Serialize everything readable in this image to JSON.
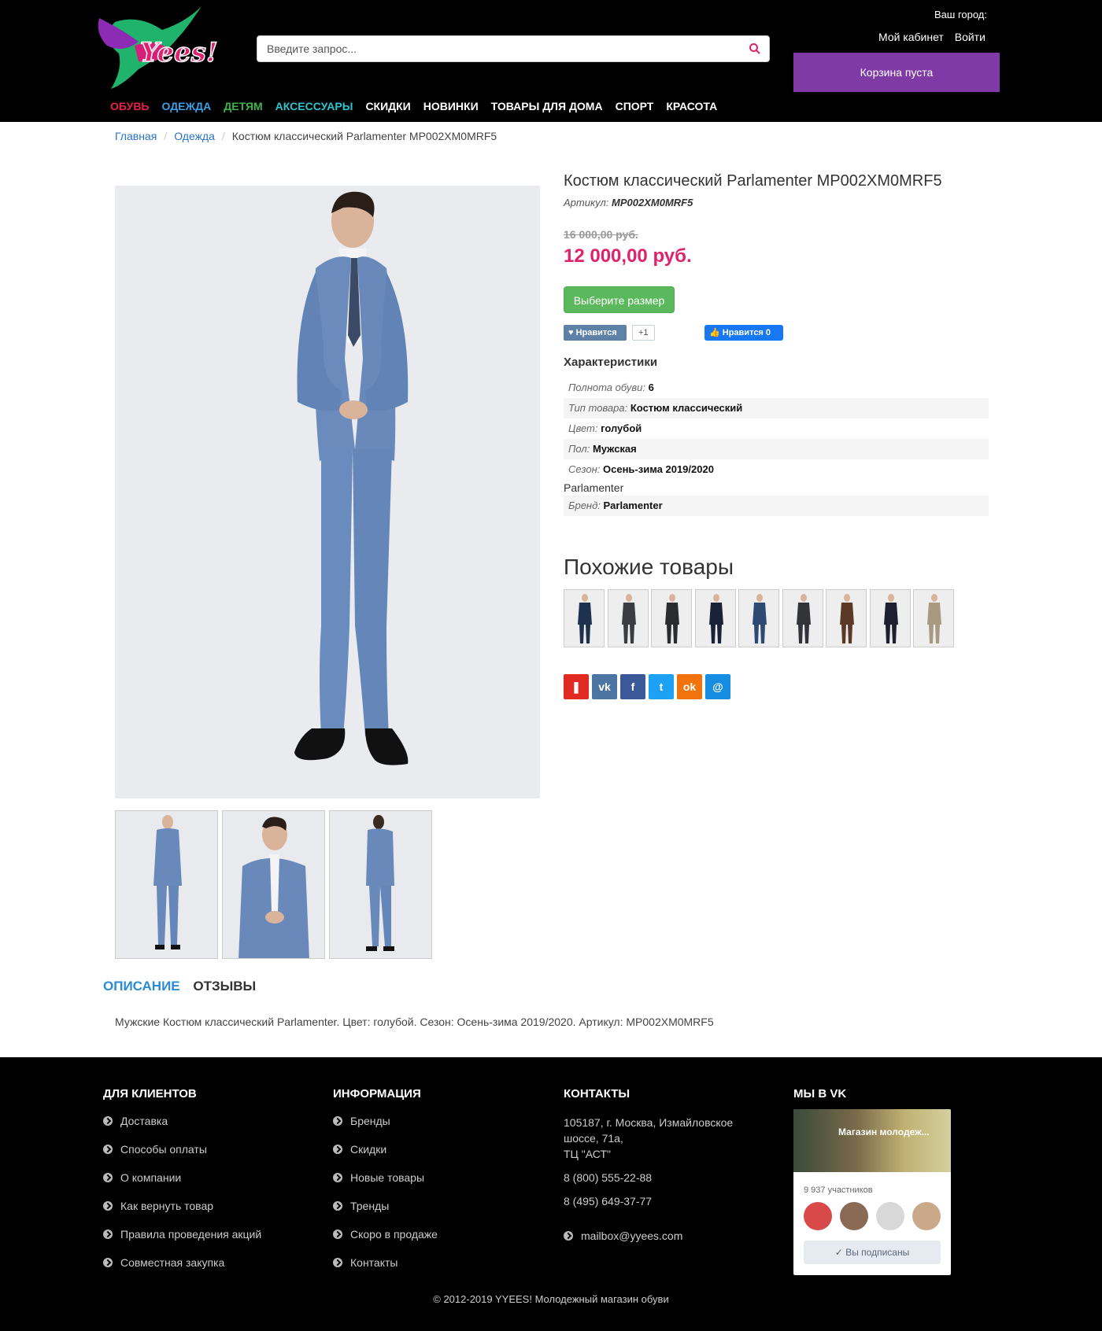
{
  "header": {
    "search_placeholder": "Введите запрос...",
    "city_label": "Ваш город:",
    "account_label": "Мой кабинет",
    "login_label": "Войти",
    "cart_label": "Корзина пуста",
    "logo_text": "Yees!"
  },
  "nav": [
    {
      "label": "ОБУВЬ",
      "color": "#e8204e"
    },
    {
      "label": "ОДЕЖДА",
      "color": "#3aa0e8"
    },
    {
      "label": "ДЕТЯМ",
      "color": "#3cb44a"
    },
    {
      "label": "АКСЕССУАРЫ",
      "color": "#29c6d0"
    },
    {
      "label": "СКИДКИ",
      "color": "#ffffff"
    },
    {
      "label": "НОВИНКИ",
      "color": "#ffffff"
    },
    {
      "label": "ТОВАРЫ ДЛЯ ДОМА",
      "color": "#ffffff"
    },
    {
      "label": "СПОРТ",
      "color": "#ffffff"
    },
    {
      "label": "КРАСОТА",
      "color": "#ffffff"
    }
  ],
  "breadcrumb": {
    "home": "Главная",
    "category": "Одежда",
    "current": "Костюм классический Parlamenter MP002XM0MRF5"
  },
  "product": {
    "title": "Костюм классический Parlamenter MP002XM0MRF5",
    "article_label": "Артикул:",
    "article_value": "MP002XM0MRF5",
    "old_price": "16 000,00 руб.",
    "new_price": "12 000,00 руб.",
    "size_button": "Выберите размер",
    "vk_like": "Нравится",
    "vk_count": "+1",
    "fb_like": "Нравится 0",
    "characteristics_title": "Характеристики",
    "chars": [
      {
        "label": "Полнота обуви:",
        "value": "6"
      },
      {
        "label": "Тип товара:",
        "value": "Костюм классический"
      },
      {
        "label": "Цвет:",
        "value": "голубой"
      },
      {
        "label": "Пол:",
        "value": "Мужская"
      },
      {
        "label": "Сезон:",
        "value": "Осень-зима 2019/2020"
      }
    ],
    "brand_plain": "Parlamenter",
    "brand_label": "Бренд:",
    "brand_value": "Parlamenter",
    "similar_title": "Похожие товары"
  },
  "similar_colors": [
    "#1e3250",
    "#3a3e44",
    "#2a2c30",
    "#1a2238",
    "#2c4a74",
    "#32343a",
    "#5a3a26",
    "#1c2030",
    "#a89a80"
  ],
  "share": [
    {
      "icon": "bookmark-icon",
      "glyph": "❚",
      "color": "#e02a22"
    },
    {
      "icon": "vk-icon",
      "glyph": "vk",
      "color": "#4c75a3"
    },
    {
      "icon": "facebook-icon",
      "glyph": "f",
      "color": "#3b5998"
    },
    {
      "icon": "twitter-icon",
      "glyph": "t",
      "color": "#1da1f2"
    },
    {
      "icon": "odnoklassniki-icon",
      "glyph": "ok",
      "color": "#f2720c"
    },
    {
      "icon": "moimir-icon",
      "glyph": "@",
      "color": "#168de2"
    }
  ],
  "tabs": {
    "description": "ОПИСАНИЕ",
    "reviews": "ОТЗЫВЫ"
  },
  "description_text": "Мужские Костюм классический Parlamenter. Цвет: голубой. Сезон: Осень-зима 2019/2020. Артикул: MP002XM0MRF5",
  "footer": {
    "clients_title": "ДЛЯ КЛИЕНТОВ",
    "clients": [
      "Доставка",
      "Способы оплаты",
      "О компании",
      "Как вернуть товар",
      "Правила проведения акций",
      "Совместная закупка"
    ],
    "info_title": "ИНФОРМАЦИЯ",
    "info": [
      "Бренды",
      "Скидки",
      "Новые товары",
      "Тренды",
      "Скоро в продаже",
      "Контакты"
    ],
    "contacts_title": "КОНТАКТЫ",
    "address1": "105187, г. Москва, Измайловское",
    "address2": "шоссе, 71а,",
    "address3": "ТЦ \"АСТ\"",
    "phone1": "8 (800) 555-22-88",
    "phone2": "8 (495) 649-37-77",
    "email": "mailbox@yyees.com",
    "vk_title": "МЫ В VK",
    "vk_group": "Магазин молодеж...",
    "vk_members": "9 937 участников",
    "vk_subscribed": "Вы подписаны",
    "copyright": "© 2012-2019 YYEES! Молодежный магазин обуви"
  }
}
